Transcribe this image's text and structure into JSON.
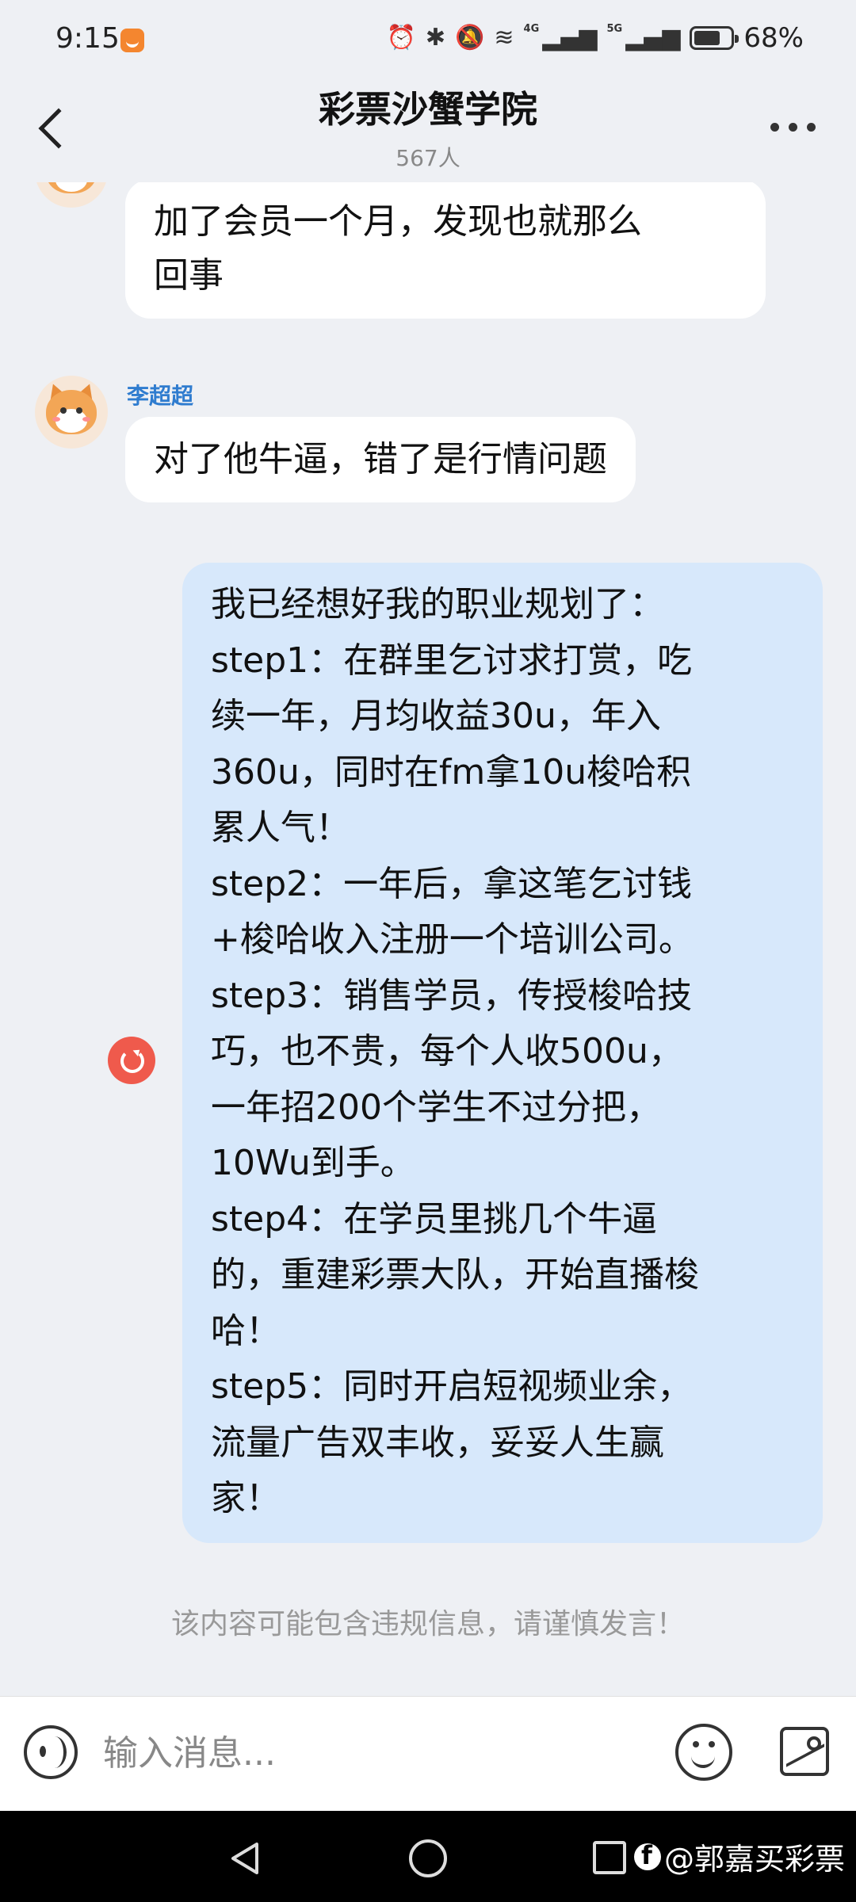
{
  "status_bar": {
    "time": "9:15",
    "network_label": "4G",
    "network_label_2": "5G",
    "battery_percent": "68%"
  },
  "header": {
    "title": "彩票沙蟹学院",
    "member_count": "567人"
  },
  "messages": [
    {
      "direction": "incoming",
      "sender": "",
      "text": "加了会员一个月，发现也就那么\n回事"
    },
    {
      "direction": "incoming",
      "sender": "李超超",
      "text": "对了他牛逼，错了是行情问题"
    },
    {
      "direction": "outgoing",
      "status": "failed",
      "text": "我已经想好我的职业规划了：\nstep1：在群里乞讨求打赏，吃\n续一年，月均收益30u，年入\n360u，同时在fm拿10u梭哈积\n累人气！\nstep2：一年后，拿这笔乞讨钱\n+梭哈收入注册一个培训公司。\nstep3：销售学员，传授梭哈技\n巧，也不贵，每个人收500u，\n一年招200个学生不过分把，\n10Wu到手。\nstep4：在学员里挑几个牛逼\n的，重建彩票大队，开始直播梭\n哈！\nstep5：同时开启短视频业余，\n流量广告双丰收，妥妥人生赢\n家！"
    }
  ],
  "warning_text": "该内容可能包含违规信息，请谨慎发言！",
  "input_bar": {
    "placeholder": "输入消息..."
  },
  "watermark": "@郭嘉买彩票",
  "colors": {
    "background": "#eef0f4",
    "incoming_bubble": "#ffffff",
    "outgoing_bubble": "#d7e8fb",
    "sender_name": "#2f7ccf",
    "resend_badge": "#ef5a4c"
  },
  "icons": [
    "back-icon",
    "more-icon",
    "resend-icon",
    "voice-icon",
    "emoji-icon",
    "image-icon",
    "nav-back-icon",
    "nav-home-icon",
    "nav-recent-icon"
  ]
}
